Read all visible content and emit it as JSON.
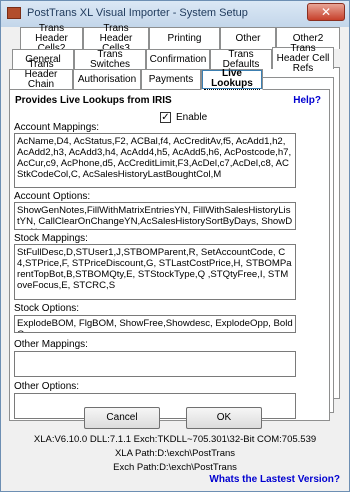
{
  "window": {
    "title": "PostTrans XL Visual Importer - System Setup",
    "close_glyph": "✕"
  },
  "tabs": {
    "row1": [
      "Trans Header Cells2",
      "Trans Header Cells3",
      "Printing",
      "Other",
      "Other2"
    ],
    "row2": [
      "General",
      "Trans Switches",
      "Confirmation",
      "Trans Defaults",
      "Trans Header Cell Refs"
    ],
    "row3": [
      "Trans Header Chain Posting",
      "Authorisation",
      "Payments",
      "Live Lookups"
    ],
    "active": "Live Lookups"
  },
  "live_lookups": {
    "heading": "Provides Live Lookups from IRIS",
    "help_label": "Help?",
    "enable_label": "Enable",
    "enable_checked": true,
    "check_glyph": "✓",
    "account_mappings_label": "Account Mappings:",
    "account_mappings_value": "AcName,D4, AcStatus,F2, ACBal,f4, AcCreditAv,f5, AcAdd1,h2, AcAdd2,h3, AcAdd3,h4, AcAdd4,h5, AcAdd5,h6, AcPostcode,h7, AcCur,c9, AcPhone,d5, AcCreditLimit,F3,AcDel,c7,AcDel,c8, ACStkCodeCol,C, AcSalesHistoryLastBoughtCol,M",
    "account_options_label": "Account Options:",
    "account_options_value": "ShowGenNotes,FillWithMatrixEntriesYN, FillWithSalesHistoryListYN, CallClearOnChangeYN,AcSalesHistorySortByDays, ShowDateNotes",
    "stock_mappings_label": "Stock Mappings:",
    "stock_mappings_value": "StFullDesc,D,STUser1,J,STBOMParent,R, SetAccountCode, C4,STPrice,F, STPriceDiscount,G, STLastCostPrice,H, STBOMParentTopBot,B,STBOMQty,E, STStockType,Q ,STQtyFree,I, STMoveFocus,E, STCRC,S",
    "stock_options_label": "Stock Options:",
    "stock_options_value": "ExplodeBOM, FlgBOM, ShowFree,Showdesc, ExplodeOpp, BoldOpp,",
    "other_mappings_label": "Other Mappings:",
    "other_mappings_value": "",
    "other_options_label": "Other Options:",
    "other_options_value": ""
  },
  "buttons": {
    "cancel": "Cancel",
    "ok": "OK"
  },
  "footer": {
    "versions": "XLA:V6.10.0 DLL:7.1.1   Exch:TKDLL~705.301\\32-Bit COM:705.539",
    "xla_path": "XLA Path:D:\\exch\\PostTrans",
    "exch_path": "Exch Path:D:\\exch\\PostTrans",
    "latest_link": "Whats the Lastest Version?"
  }
}
